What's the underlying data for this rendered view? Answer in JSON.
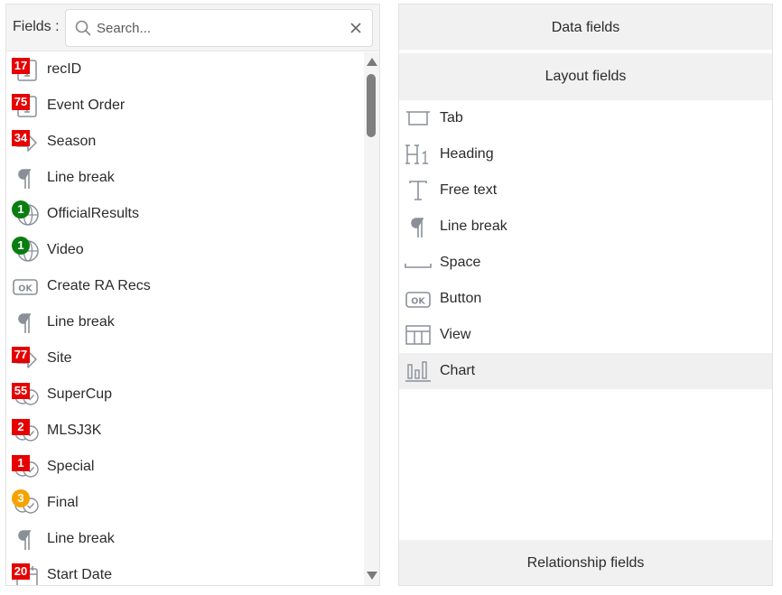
{
  "left": {
    "fields_label": "Fields :",
    "search_placeholder": "Search...",
    "search_value": "",
    "items": [
      {
        "label": "recID",
        "icon": "number-field-icon",
        "badge": "17",
        "badge_color": "#e60000"
      },
      {
        "label": "Event Order",
        "icon": "number-field-icon",
        "badge": "75",
        "badge_color": "#e60000"
      },
      {
        "label": "Season",
        "icon": "lookup-arrow-icon",
        "badge": "34",
        "badge_color": "#e60000"
      },
      {
        "label": "Line break",
        "icon": "pilcrow-icon",
        "badge": null,
        "badge_color": null
      },
      {
        "label": "OfficialResults",
        "icon": "globe-icon",
        "badge": "1",
        "badge_color": "#0a7d10"
      },
      {
        "label": "Video",
        "icon": "globe-icon",
        "badge": "1",
        "badge_color": "#0a7d10"
      },
      {
        "label": "Create RA Recs",
        "icon": "ok-button-icon",
        "badge": null,
        "badge_color": null
      },
      {
        "label": "Line break",
        "icon": "pilcrow-icon",
        "badge": null,
        "badge_color": null
      },
      {
        "label": "Site",
        "icon": "lookup-arrow-icon",
        "badge": "77",
        "badge_color": "#e60000"
      },
      {
        "label": "SuperCup",
        "icon": "checkbox-toggle-icon",
        "badge": "55",
        "badge_color": "#e60000"
      },
      {
        "label": "MLSJ3K",
        "icon": "checkbox-toggle-icon",
        "badge": "2",
        "badge_color": "#e60000"
      },
      {
        "label": "Special",
        "icon": "checkbox-toggle-icon",
        "badge": "1",
        "badge_color": "#e60000"
      },
      {
        "label": "Final",
        "icon": "checkbox-toggle-icon",
        "badge": "3",
        "badge_color": "#f4a300"
      },
      {
        "label": "Line break",
        "icon": "pilcrow-icon",
        "badge": null,
        "badge_color": null
      },
      {
        "label": "Start Date",
        "icon": "calendar-icon",
        "badge": "20",
        "badge_color": "#e60000"
      }
    ]
  },
  "right": {
    "data_fields_label": "Data fields",
    "layout_fields_label": "Layout fields",
    "relationship_fields_label": "Relationship fields",
    "layout_items": [
      {
        "label": "Tab",
        "icon": "tab-icon"
      },
      {
        "label": "Heading",
        "icon": "heading-icon"
      },
      {
        "label": "Free text",
        "icon": "text-icon"
      },
      {
        "label": "Line break",
        "icon": "pilcrow-icon"
      },
      {
        "label": "Space",
        "icon": "space-icon"
      },
      {
        "label": "Button",
        "icon": "ok-button-icon"
      },
      {
        "label": "View",
        "icon": "table-view-icon"
      },
      {
        "label": "Chart",
        "icon": "bar-chart-icon"
      }
    ],
    "active_layout_item": "Chart"
  }
}
